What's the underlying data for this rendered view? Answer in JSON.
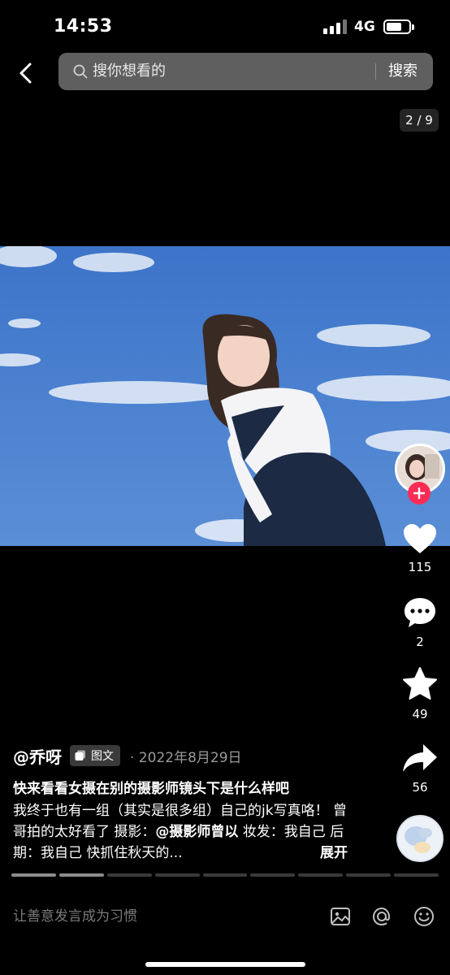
{
  "status_bar": {
    "time": "14:53",
    "network": "4G"
  },
  "search": {
    "placeholder": "搜你想看的",
    "button_label": "搜索"
  },
  "gallery": {
    "page_counter": "2 / 9",
    "current_page": 2,
    "total_pages": 9
  },
  "actions": {
    "likes": "115",
    "comments": "2",
    "favorites": "49",
    "shares": "56"
  },
  "post": {
    "author": "@乔呀",
    "tag_label": "图文",
    "date": "· 2022年8月29日",
    "title": "快来看看女摄在别的摄影师镜头下是什么样吧",
    "description_pre": "我终于也有一组（其实是很多组）自己的jk写真咯！ 曾哥拍的太好看了 摄影：",
    "description_mention": "@摄影师曾以",
    "description_post": " 妆发：我自己 后期：我自己 快抓住秋天的...",
    "expand_label": "展开"
  },
  "comment_bar": {
    "placeholder": "让善意发言成为习惯"
  },
  "icons": {
    "back": "back-chevron-icon",
    "search": "search-icon",
    "like": "heart-icon",
    "comment": "comment-bubble-icon",
    "favorite": "star-icon",
    "share": "share-arrow-icon",
    "follow": "plus-icon",
    "image": "image-icon",
    "mention": "at-icon",
    "emoji": "emoji-icon"
  },
  "colors": {
    "accent": "#fe2c55",
    "sky": "#4a7fcf",
    "search_bg": "#5f5f5f"
  }
}
